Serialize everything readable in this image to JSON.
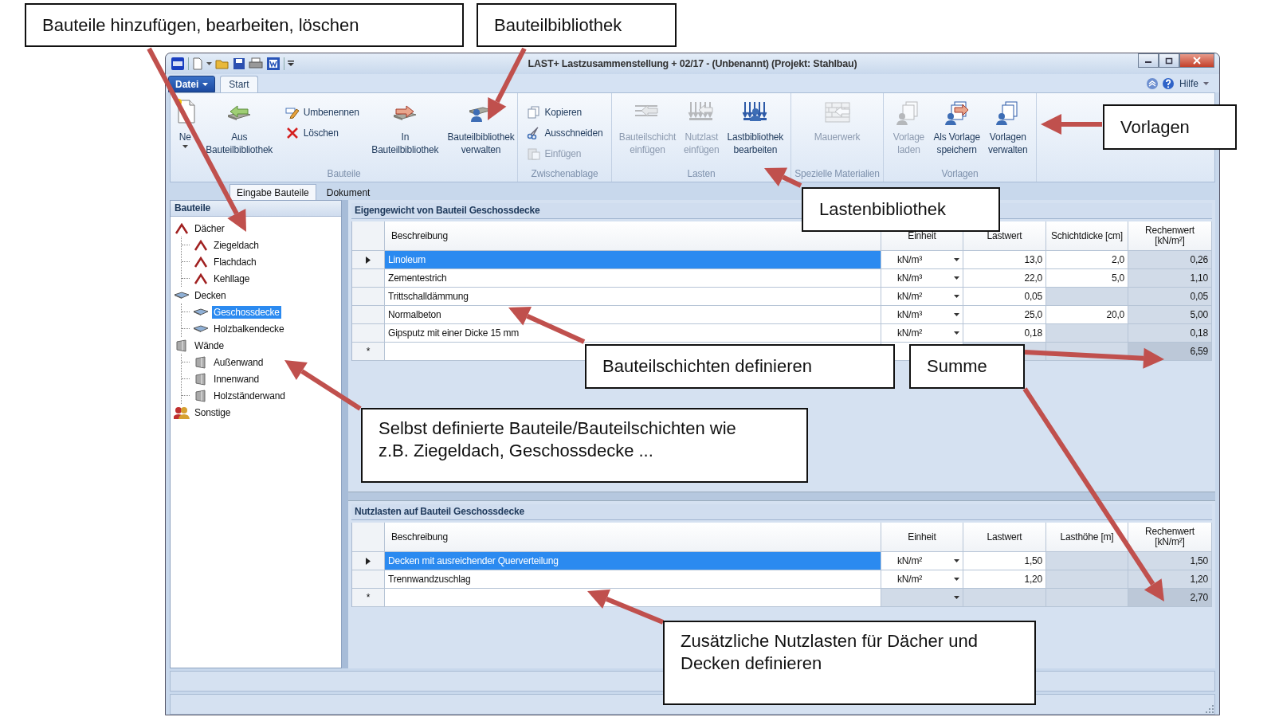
{
  "window": {
    "title": "LAST+ Lastzusammenstellung + 02/17 - (Unbenannt) (Projekt: Stahlbau)"
  },
  "menu_tabs": [
    {
      "label": "Datei",
      "kind": "file",
      "selected": false
    },
    {
      "label": "Start",
      "kind": "tab",
      "selected": true
    }
  ],
  "help": {
    "label": "Hilfe"
  },
  "ribbon": {
    "groups": [
      {
        "title": "Bauteile",
        "items": [
          {
            "label": "Ne",
            "kind": "large",
            "dropdown": true,
            "disabled": false
          },
          {
            "label": "Aus\nBauteilbibliothek",
            "kind": "large",
            "dropdown": false,
            "disabled": false
          },
          {
            "label": "Umbenennen",
            "kind": "small",
            "dropdown": false,
            "disabled": false
          },
          {
            "label": "Löschen",
            "kind": "small",
            "dropdown": false,
            "disabled": false
          },
          {
            "label": "In\nBauteilbibliothek",
            "kind": "large",
            "dropdown": false,
            "disabled": false
          },
          {
            "label": "Bauteilbibliothek\nverwalten",
            "kind": "large",
            "dropdown": false,
            "disabled": false
          }
        ]
      },
      {
        "title": "Zwischenablage",
        "items": [
          {
            "label": "Kopieren",
            "kind": "small",
            "dropdown": false,
            "disabled": false
          },
          {
            "label": "Ausschneiden",
            "kind": "small",
            "dropdown": false,
            "disabled": false
          },
          {
            "label": "Einfügen",
            "kind": "small",
            "dropdown": false,
            "disabled": true
          }
        ]
      },
      {
        "title": "Lasten",
        "items": [
          {
            "label": "Bauteilschicht\neinfügen",
            "kind": "large",
            "dropdown": false,
            "disabled": true
          },
          {
            "label": "Nutzlast\neinfügen",
            "kind": "large",
            "dropdown": false,
            "disabled": true
          },
          {
            "label": "Lastbibliothek\nbearbeiten",
            "kind": "large",
            "dropdown": false,
            "disabled": false
          }
        ]
      },
      {
        "title": "Spezielle Materialien",
        "items": [
          {
            "label": "Mauerwerk",
            "kind": "large",
            "dropdown": false,
            "disabled": true
          }
        ]
      },
      {
        "title": "Vorlagen",
        "items": [
          {
            "label": "Vorlage\nladen",
            "kind": "large",
            "dropdown": false,
            "disabled": true
          },
          {
            "label": "Als Vorlage\nspeichern",
            "kind": "large",
            "dropdown": false,
            "disabled": false
          },
          {
            "label": "Vorlagen\nverwalten",
            "kind": "large",
            "dropdown": false,
            "disabled": false
          }
        ]
      }
    ]
  },
  "content_tabs": [
    {
      "label": "Eingabe Bauteile",
      "selected": true
    },
    {
      "label": "Dokument",
      "selected": false
    }
  ],
  "tree": {
    "title": "Bauteile",
    "items": [
      {
        "label": "Dächer",
        "kind": "roof",
        "selected": false,
        "children": [
          {
            "label": "Ziegeldach",
            "selected": false
          },
          {
            "label": "Flachdach",
            "selected": false
          },
          {
            "label": "Kehllage",
            "selected": false
          }
        ]
      },
      {
        "label": "Decken",
        "kind": "slab",
        "selected": false,
        "children": [
          {
            "label": "Geschossdecke",
            "selected": true
          },
          {
            "label": "Holzbalkendecke",
            "selected": false
          }
        ]
      },
      {
        "label": "Wände",
        "kind": "wall",
        "selected": false,
        "children": [
          {
            "label": "Außenwand",
            "selected": false
          },
          {
            "label": "Innenwand",
            "selected": false
          },
          {
            "label": "Holzständerwand",
            "selected": false
          }
        ]
      },
      {
        "label": "Sonstige",
        "kind": "people",
        "selected": false
      }
    ]
  },
  "sections": [
    {
      "title": "Eigengewicht von Bauteil Geschossdecke",
      "columns": [
        "Beschreibung",
        "Einheit",
        "Lastwert",
        "Schichtdicke [cm]",
        "Rechenwert\n[kN/m²]"
      ],
      "rows": [
        {
          "cells": [
            "Linoleum",
            "kN/m³",
            "13,0",
            "2,0",
            "0,26"
          ],
          "selected": true
        },
        {
          "cells": [
            "Zementestrich",
            "kN/m³",
            "22,0",
            "5,0",
            "1,10"
          ],
          "selected": false
        },
        {
          "cells": [
            "Trittschalldämmung",
            "kN/m²",
            "0,05",
            null,
            "0,05"
          ],
          "selected": false
        },
        {
          "cells": [
            "Normalbeton",
            "kN/m³",
            "25,0",
            "20,0",
            "5,00"
          ],
          "selected": false
        },
        {
          "cells": [
            "Gipsputz mit einer Dicke 15 mm",
            "kN/m²",
            "0,18",
            null,
            "0,18"
          ],
          "selected": false
        }
      ],
      "new_row_marker": "*",
      "total": "6,59"
    },
    {
      "title": "Nutzlasten auf Bauteil Geschossdecke",
      "columns": [
        "Beschreibung",
        "Einheit",
        "Lastwert",
        "Lasthöhe [m]",
        "Rechenwert\n[kN/m²]"
      ],
      "rows": [
        {
          "cells": [
            "Decken mit ausreichender Querverteilung",
            "kN/m²",
            "1,50",
            null,
            "1,50"
          ],
          "selected": true
        },
        {
          "cells": [
            "Trennwandzuschlag",
            "kN/m²",
            "1,20",
            null,
            "1,20"
          ],
          "selected": false
        }
      ],
      "new_row_marker": "*",
      "total": "2,70"
    }
  ],
  "annotations": [
    {
      "text": "Bauteile hinzufügen, bearbeiten, löschen"
    },
    {
      "text": "Bauteilbibliothek"
    },
    {
      "text": "Vorlagen"
    },
    {
      "text": "Lastenbibliothek"
    },
    {
      "text": "Bauteilschichten definieren"
    },
    {
      "text": "Summe"
    },
    {
      "text": "Selbst definierte Bauteile/Bauteilschichten wie\nz.B. Ziegeldach, Geschossdecke ..."
    },
    {
      "text": "Zusätzliche Nutzlasten für Dächer und\nDecken definieren"
    }
  ]
}
